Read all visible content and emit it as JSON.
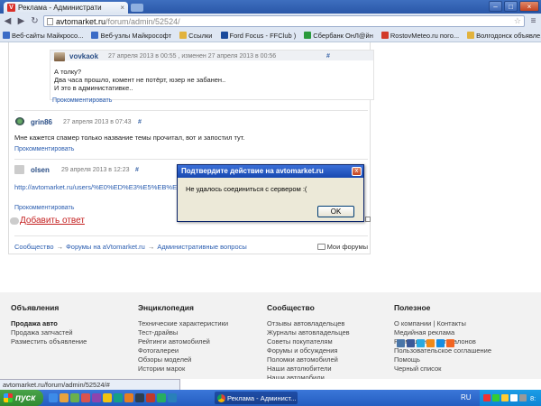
{
  "browser": {
    "tab_title": "Реклама - Администрати",
    "favicon_letter": "V",
    "url_host": "avtomarket.ru",
    "url_path": "/forum/admin/52524/",
    "bookmarks": [
      {
        "label": "Веб-сайты Майкросо...",
        "color": "#3b6bc6"
      },
      {
        "label": "Веб-узлы Майкрософт",
        "color": "#3b6bc6"
      },
      {
        "label": "Ссылки",
        "color": "#e2b23c"
      },
      {
        "label": "Ford Focus - FFClub )",
        "color": "#1a4a9c"
      },
      {
        "label": "Сбербанк ОнЛ@йн",
        "color": "#2a9a3c"
      },
      {
        "label": "RostovMeteo.ru пого...",
        "color": "#d23a2a"
      },
      {
        "label": "Волгодонск объявле...",
        "color": "#e2b23c"
      }
    ]
  },
  "posts": {
    "quote": {
      "author": "vovkaok",
      "date": "27 апреля 2013 в 00:55 , изменен 27 апреля 2013 в 00:56",
      "hash": "#",
      "lines": [
        "А толку?",
        "Два часа прошло, комент не потёрт, юзер не забанен..",
        "И это в администативке.."
      ],
      "comment_link": "Прокомментировать"
    },
    "post1": {
      "author": "grin86",
      "date": "27 апреля 2013 в 07:43",
      "hash": "#",
      "text": "Мне кажется спамер только название темы прочитал, вот и запостил тут.",
      "comment_link": "Прокомментировать"
    },
    "post2": {
      "author": "olsen",
      "date": "29 апреля 2013 в 12:23",
      "hash": "#",
      "url": "http://avtomarket.ru/users/%E0%ED%E3%E5%EB%E8%",
      "comment_link": "Прокомментировать"
    },
    "add_reply": "Добавить ответ"
  },
  "breadcrumbs": {
    "items": [
      "Сообщество",
      "Форумы на aVtomarket.ru",
      "Административные вопросы"
    ],
    "separator": "→",
    "my_forums": "Мои форумы"
  },
  "footer": {
    "columns": [
      {
        "title": "Объявления",
        "links": [
          "Продажа авто",
          "Продажа запчастей",
          "Разместить объявление"
        ]
      },
      {
        "title": "Энциклопедия",
        "links": [
          "Технические характеристики",
          "Тест-драйвы",
          "Рейтинги автомобилей",
          "Фотогалереи",
          "Обзоры моделей",
          "Истории марок"
        ]
      },
      {
        "title": "Сообщество",
        "links": [
          "Отзывы автовладельцев",
          "Журналы автовладельцев",
          "Советы покупателям",
          "Форумы и обсуждения",
          "Поломки автомобилей",
          "Наши автолюбители",
          "Наши автомобили"
        ]
      },
      {
        "title": "Полезное",
        "links": [
          "О компании | Контакты",
          "Медийная реклама",
          "Размещение автосалонов",
          "Пользовательское соглашение",
          "Помощь",
          "Черный список"
        ]
      }
    ]
  },
  "statusbar": "avtomarket.ru/forum/admin/52524/#",
  "dialog": {
    "title": "Подтвердите действие на avtomarket.ru",
    "message": "Не удалось соединиться с сервером :(",
    "ok_label": "OK",
    "close_glyph": "x"
  },
  "taskbar": {
    "start_label": "пуск",
    "task_label": "Реклама - Админист...",
    "lang": "RU",
    "clock": "8:"
  }
}
